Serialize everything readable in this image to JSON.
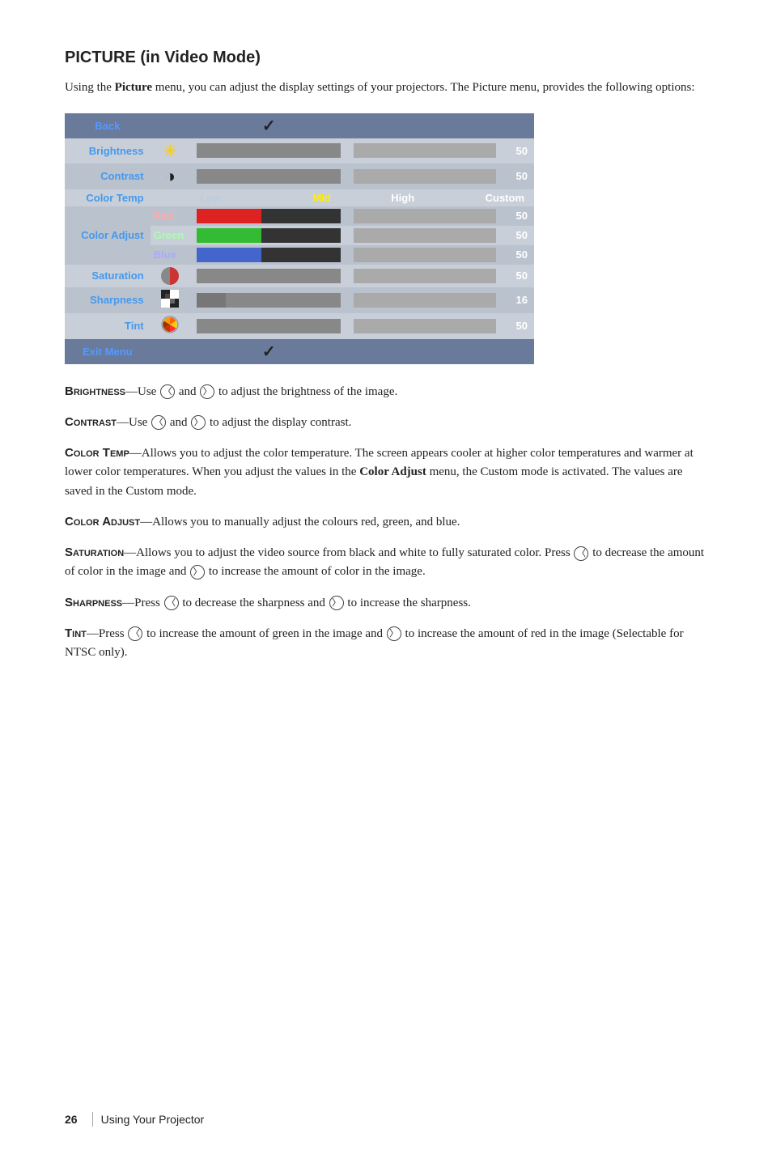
{
  "page": {
    "title": "PICTURE (in Video Mode)",
    "intro": "Using the Picture menu, you can adjust the display settings of your projectors. The Picture menu, provides the following options:",
    "footer_page": "26",
    "footer_text": "Using Your Projector"
  },
  "menu": {
    "back_label": "Back",
    "rows": [
      {
        "label": "Brightness",
        "has_icon": "brightness",
        "value": "50"
      },
      {
        "label": "Contrast",
        "has_icon": "contrast",
        "value": "50"
      },
      {
        "label": "Color Temp",
        "has_icon": "colortemp",
        "value": ""
      },
      {
        "label": "Color Adjust",
        "has_icon": "coloradjust",
        "sub": [
          {
            "name": "Red",
            "color": "red",
            "value": "50"
          },
          {
            "name": "Green",
            "color": "green",
            "value": "50"
          },
          {
            "name": "Blue",
            "color": "blue",
            "value": "50"
          }
        ]
      },
      {
        "label": "Saturation",
        "has_icon": "saturation",
        "value": "50"
      },
      {
        "label": "Sharpness",
        "has_icon": "sharpness",
        "value": "16"
      },
      {
        "label": "Tint",
        "has_icon": "tint",
        "value": "50"
      }
    ],
    "exit_label": "Exit Menu",
    "color_temp_options": [
      "Low",
      "Mid",
      "High",
      "Custom"
    ]
  },
  "descriptions": [
    {
      "term": "Brightness",
      "text": "—Use",
      "detail": "and",
      "detail2": "to adjust the brightness of the image.",
      "left_btn": "〈",
      "right_btn": "〉"
    },
    {
      "term": "Contrast",
      "text": "—Use",
      "detail": "and",
      "detail2": "to adjust the display contrast.",
      "left_btn": "〈",
      "right_btn": "〉"
    },
    {
      "term": "Color Temp",
      "full_text": "—Allows you to adjust the color temperature. The screen appears cooler at higher color temperatures and warmer at lower color temperatures. When you adjust the values in the Color Adjust menu, the Custom mode is activated. The values are saved in the Custom mode."
    },
    {
      "term": "Color Adjust",
      "full_text": "—Allows you to manually adjust the colours red, green, and blue."
    },
    {
      "term": "Saturation",
      "full_text": "—Allows you to adjust the video source from black and white to fully saturated color. Press",
      "detail": "to decrease the amount of color in the image and",
      "detail2": "to increase the amount of color in the image.",
      "left_btn": "〈",
      "right_btn": "〉"
    },
    {
      "term": "Sharpness",
      "full_text": "—Press",
      "detail": "to decrease the sharpness and",
      "detail2": "to increase the sharpness.",
      "left_btn": "〈",
      "right_btn": "〉"
    },
    {
      "term": "Tint",
      "full_text": "—Press",
      "detail": "to increase the amount of green in the image and",
      "detail2": "to increase the amount of red in the image (Selectable for NTSC only).",
      "left_btn": "〈",
      "right_btn": "〉"
    }
  ]
}
